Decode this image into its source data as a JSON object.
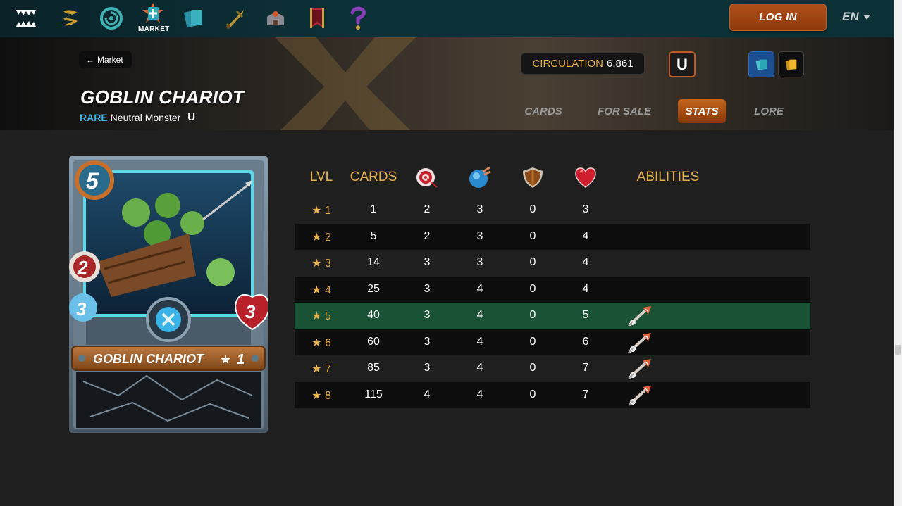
{
  "nav": {
    "items": [
      {
        "icon": "splinterlands-logo-icon"
      },
      {
        "icon": "rewards-icon"
      },
      {
        "icon": "battle-icon"
      },
      {
        "icon": "market-icon",
        "label": "MARKET"
      },
      {
        "icon": "collection-icon"
      },
      {
        "icon": "guild-icon"
      },
      {
        "icon": "castle-icon"
      },
      {
        "icon": "banner-icon"
      },
      {
        "icon": "help-icon"
      }
    ],
    "login_label": "LOG IN",
    "language": "EN"
  },
  "header": {
    "back_label": "Market",
    "title": "GOBLIN CHARIOT",
    "rarity": "RARE",
    "type": "Neutral Monster",
    "edition_mark": "U",
    "circulation_label": "CIRCULATION",
    "circulation_value": "6,861",
    "edition_button": "U",
    "tabs": [
      {
        "label": "CARDS",
        "active": false
      },
      {
        "label": "FOR SALE",
        "active": false
      },
      {
        "label": "STATS",
        "active": true
      },
      {
        "label": "LORE",
        "active": false
      }
    ]
  },
  "card": {
    "mana": "5",
    "attack": "2",
    "speed": "3",
    "health": "3",
    "name": "GOBLIN CHARIOT",
    "level": "1"
  },
  "stats": {
    "headers": {
      "lvl": "LVL",
      "cards": "CARDS",
      "abilities": "ABILITIES"
    },
    "header_icons": [
      "ranged-attack-icon",
      "speed-icon",
      "armor-icon",
      "health-icon"
    ],
    "rows": [
      {
        "lvl": "1",
        "cards": "1",
        "atk": "2",
        "spd": "3",
        "arm": "0",
        "hp": "3",
        "ability": ""
      },
      {
        "lvl": "2",
        "cards": "5",
        "atk": "2",
        "spd": "3",
        "arm": "0",
        "hp": "4",
        "ability": ""
      },
      {
        "lvl": "3",
        "cards": "14",
        "atk": "3",
        "spd": "3",
        "arm": "0",
        "hp": "4",
        "ability": ""
      },
      {
        "lvl": "4",
        "cards": "25",
        "atk": "3",
        "spd": "4",
        "arm": "0",
        "hp": "4",
        "ability": ""
      },
      {
        "lvl": "5",
        "cards": "40",
        "atk": "3",
        "spd": "4",
        "arm": "0",
        "hp": "5",
        "ability": "ability-icon"
      },
      {
        "lvl": "6",
        "cards": "60",
        "atk": "3",
        "spd": "4",
        "arm": "0",
        "hp": "6",
        "ability": "ability-icon"
      },
      {
        "lvl": "7",
        "cards": "85",
        "atk": "3",
        "spd": "4",
        "arm": "0",
        "hp": "7",
        "ability": "ability-icon"
      },
      {
        "lvl": "8",
        "cards": "115",
        "atk": "4",
        "spd": "4",
        "arm": "0",
        "hp": "7",
        "ability": "ability-icon"
      }
    ],
    "highlighted_level": 5
  },
  "colors": {
    "accent_orange": "#b0501c",
    "gold_text": "#e8b049",
    "rare_blue": "#3ab3e8",
    "highlight_row": "#1a5235"
  }
}
